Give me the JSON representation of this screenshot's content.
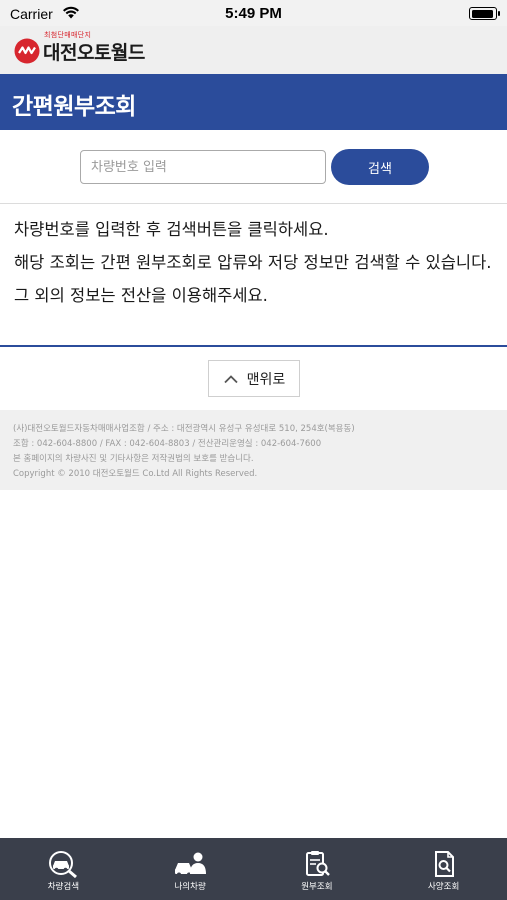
{
  "status_bar": {
    "carrier": "Carrier",
    "time": "5:49 PM"
  },
  "header": {
    "logo_tagline": "최첨단매매단지",
    "logo_text": "대전오토월드",
    "brand_color": "#d7262e",
    "page_title": "간편원부조회",
    "accent_color": "#2b4c9b"
  },
  "search": {
    "placeholder": "차량번호 입력",
    "value": "",
    "button_label": "검색"
  },
  "instructions": {
    "line1": "차량번호를 입력한 후 검색버튼을 클릭하세요.",
    "line2": "해당 조회는 간편 원부조회로 압류와 저당 정보만 검색할 수 있습니다.",
    "line3": "그 외의 정보는 전산을 이용해주세요."
  },
  "top_button": {
    "label": "맨위로",
    "icon": "chevron-up-icon"
  },
  "footer": {
    "line1": "(사)대전오토월드자동차매매사업조합 / 주소 : 대전광역시 유성구 유성대로 510, 254호(복용동)",
    "line2": "조합 : 042-604-8800 / FAX : 042-604-8803 / 전산관리운영실 : 042-604-7600",
    "line3": "본 홈페이지의 차량사진 및 기타사항은 저작권법의 보호를 받습니다.",
    "line4": "Copyright © 2010 대전오토월드 Co.Ltd All Rights Reserved."
  },
  "tab_bar": {
    "items": [
      {
        "label": "차량검색",
        "icon": "car-search-icon"
      },
      {
        "label": "나의차량",
        "icon": "my-car-icon"
      },
      {
        "label": "원부조회",
        "icon": "clipboard-search-icon"
      },
      {
        "label": "사양조회",
        "icon": "document-search-icon"
      }
    ]
  }
}
